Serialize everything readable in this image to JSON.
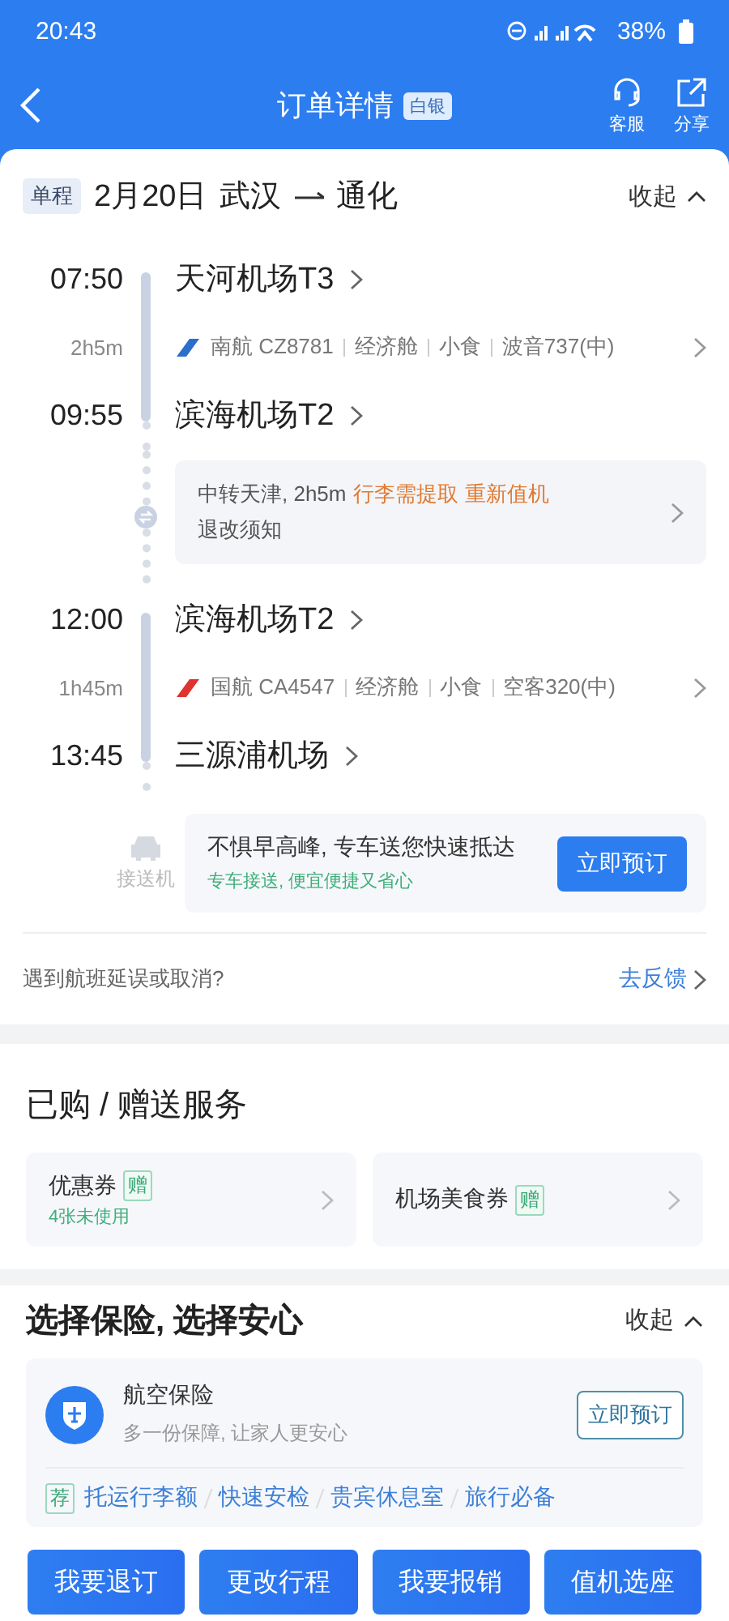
{
  "status_bar": {
    "time": "20:43",
    "battery": "38%"
  },
  "nav": {
    "title": "订单详情",
    "badge": "白银",
    "actions": [
      {
        "label": "客服"
      },
      {
        "label": "分享"
      }
    ]
  },
  "trip": {
    "tag": "单程",
    "date": "2月20日",
    "from": "武汉",
    "to": "通化",
    "collapse": "收起"
  },
  "timeline": [
    {
      "kind": "departure",
      "time": "07:50",
      "airport": "天河机场T3"
    },
    {
      "kind": "flight",
      "duration": "2h5m",
      "color": "#2a6fc9",
      "details": [
        "南航 CZ8781",
        "经济舱",
        "小食",
        "波音737(中)"
      ]
    },
    {
      "kind": "arrival",
      "time": "09:55",
      "airport": "滨海机场T2"
    },
    {
      "kind": "transfer",
      "text": "中转天津, 2h5m",
      "alerts": [
        "行李需提取",
        "重新值机"
      ],
      "note": "退改须知"
    },
    {
      "kind": "departure",
      "time": "12:00",
      "airport": "滨海机场T2"
    },
    {
      "kind": "flight",
      "duration": "1h45m",
      "color": "#e0332e",
      "details": [
        "国航 CA4547",
        "经济舱",
        "小食",
        "空客320(中)"
      ]
    },
    {
      "kind": "arrival",
      "time": "13:45",
      "airport": "三源浦机场"
    },
    {
      "kind": "car",
      "label": "接送机",
      "headline": "不惧早高峰, 专车送您快速抵达",
      "sub": "专车接送, 便宜便捷又省心",
      "button": "立即预订"
    }
  ],
  "feedback": {
    "question": "遇到航班延误或取消?",
    "link": "去反馈"
  },
  "services": {
    "title": "已购 / 赠送服务",
    "items": [
      {
        "name": "优惠券",
        "tag": "赠",
        "sub": "4张未使用"
      },
      {
        "name": "机场美食券",
        "tag": "赠"
      }
    ]
  },
  "insurance": {
    "title": "选择保险, 选择安心",
    "collapse": "收起",
    "product": {
      "name": "航空保险",
      "desc": "多一份保障, 让家人更安心",
      "button": "立即预订"
    },
    "rec_tag": "荐",
    "links": [
      "托运行李额",
      "快速安检",
      "贵宾休息室",
      "旅行必备"
    ]
  },
  "actions": [
    "我要退订",
    "更改行程",
    "我要报销",
    "值机选座"
  ]
}
